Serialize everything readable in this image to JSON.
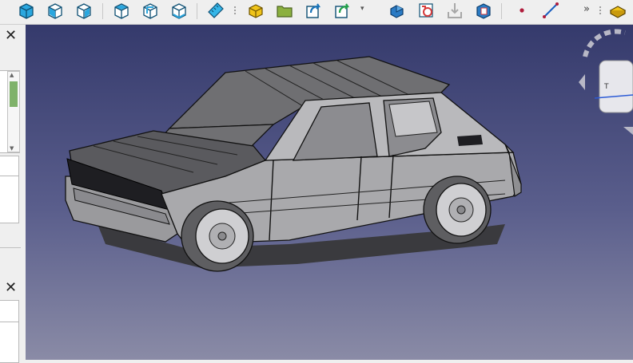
{
  "toolbar": {
    "buttons": [
      {
        "name": "view-fit-all-button",
        "icon": "fit-all-icon"
      },
      {
        "name": "view-front-button",
        "icon": "front-view-icon"
      },
      {
        "name": "view-top-button",
        "icon": "top-view-icon"
      },
      {
        "name": "view-right-button",
        "icon": "right-view-icon"
      },
      {
        "name": "view-rear-button",
        "icon": "rear-view-icon"
      },
      {
        "name": "view-bottom-button",
        "icon": "bottom-view-icon"
      },
      {
        "name": "view-left-button",
        "icon": "left-view-icon"
      },
      {
        "name": "measure-button",
        "icon": "ruler-icon"
      },
      {
        "name": "part-button",
        "icon": "part-icon"
      },
      {
        "name": "group-button",
        "icon": "folder-icon"
      },
      {
        "name": "link-button",
        "icon": "link-icon"
      },
      {
        "name": "link-actions-button",
        "icon": "link-actions-icon"
      },
      {
        "name": "body-button",
        "icon": "body-icon"
      },
      {
        "name": "sketch-button",
        "icon": "sketch-icon"
      },
      {
        "name": "import-button",
        "icon": "import-icon"
      },
      {
        "name": "export-button",
        "icon": "export-icon"
      },
      {
        "name": "point-button",
        "icon": "point-icon"
      },
      {
        "name": "line-button",
        "icon": "line-icon"
      },
      {
        "name": "workbench-button",
        "icon": "workbench-icon"
      }
    ],
    "more_label": "»",
    "dropdown_label": "▾"
  },
  "panels": {
    "top_close_label": "✕",
    "bottom_close_label": "✕"
  },
  "viewport": {
    "background_top": "#353a6c",
    "background_bottom": "#8a8ba6",
    "model_icon": "car-model-icon",
    "navcube_icon": "navigation-cube-icon"
  },
  "colors": {
    "view_icon_blue": "#1e9bd7",
    "accent_yellow": "#f0c419",
    "folder_green": "#7fa03a",
    "arrow_blue": "#1a73b8",
    "sketch_red": "#d63a3a"
  }
}
